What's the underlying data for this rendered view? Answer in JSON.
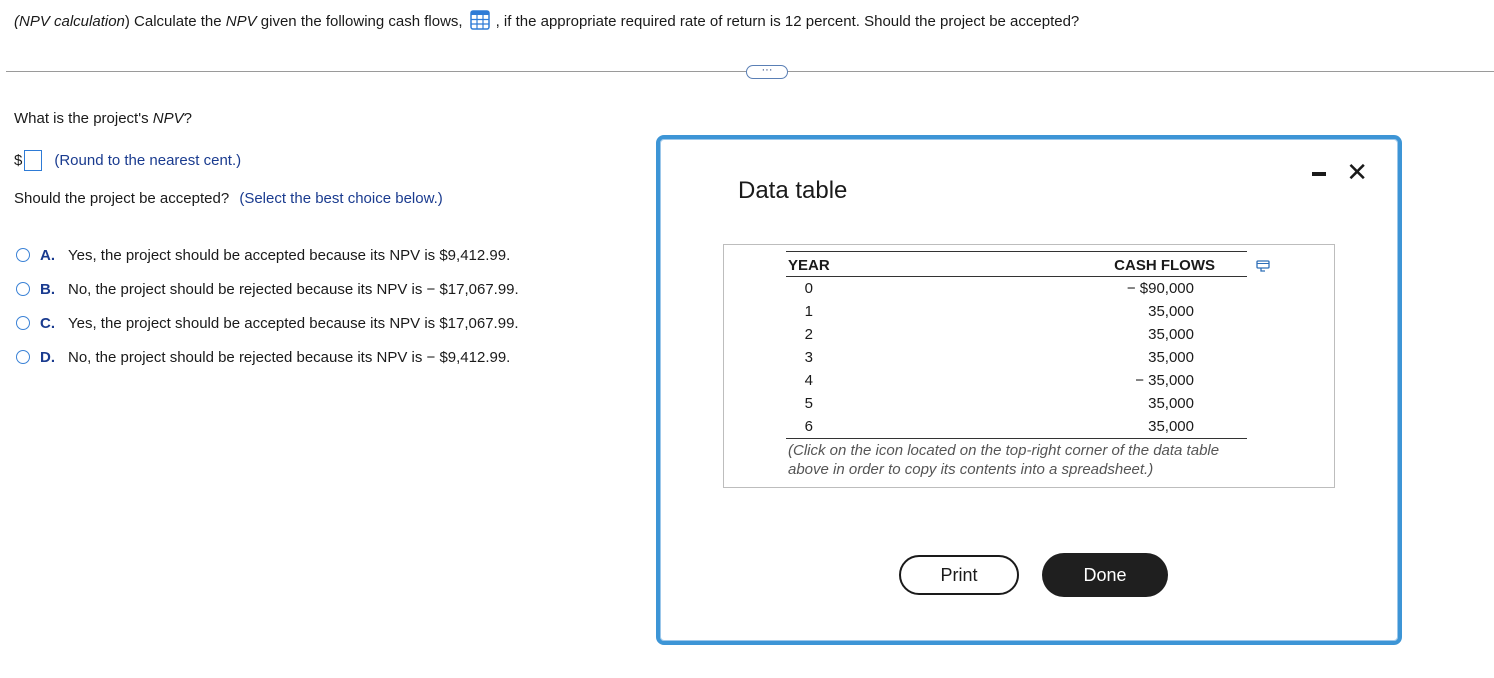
{
  "question": {
    "part1_italic": "(NPV calculation",
    "part2": ") Calculate the ",
    "part3_italic": "NPV",
    "part4": " given the following cash flows,",
    "part5": ", if the appropriate required rate of return is 12 percent. Should the project be accepted?"
  },
  "more_button_label": "···",
  "npv_prompt": {
    "text": "What is the project's ",
    "italic": "NPV",
    "end": "?"
  },
  "answer": {
    "currency": "$",
    "value": "",
    "hint": "(Round to the nearest cent.)"
  },
  "accept_prompt": {
    "text": "Should the project be accepted?",
    "hint": "(Select the best choice below.)"
  },
  "choices": [
    {
      "letter": "A.",
      "text": "Yes, the project should be accepted because its NPV is $9,412.99."
    },
    {
      "letter": "B.",
      "text": "No, the project should be rejected because its NPV is  − $17,067.99."
    },
    {
      "letter": "C.",
      "text": "Yes, the project should be accepted because its NPV is $17,067.99."
    },
    {
      "letter": "D.",
      "text": "No, the project should be rejected because its NPV is  − $9,412.99."
    }
  ],
  "modal": {
    "title": "Data table",
    "minimize_icon": "minimize-icon",
    "close_label": "✕",
    "table": {
      "headers": [
        "YEAR",
        "CASH FLOWS"
      ],
      "rows": [
        [
          "0",
          "− $90,000"
        ],
        [
          "1",
          "35,000"
        ],
        [
          "2",
          "35,000"
        ],
        [
          "3",
          "35,000"
        ],
        [
          "4",
          "− 35,000"
        ],
        [
          "5",
          "35,000"
        ],
        [
          "6",
          "35,000"
        ]
      ]
    },
    "note": "(Click on the icon located on the top-right corner of the data table above in order to copy its contents into a spreadsheet.)",
    "print_label": "Print",
    "done_label": "Done"
  },
  "colors": {
    "accent": "#3d95d6",
    "link_blue": "#1a3b8f",
    "done_bg": "#1f1f1f"
  }
}
